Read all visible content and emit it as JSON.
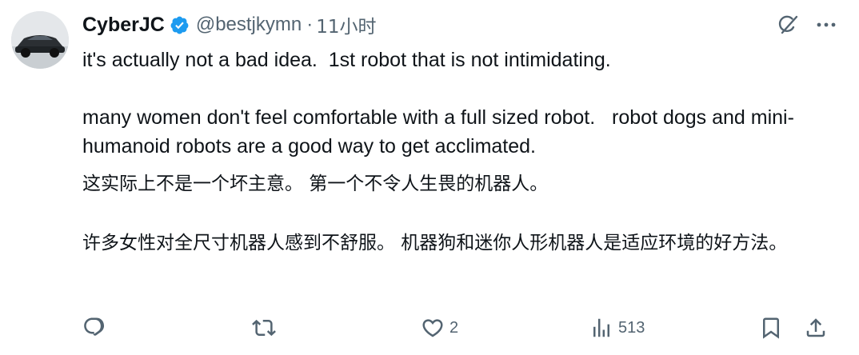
{
  "author": {
    "display_name": "CyberJC",
    "handle": "@bestjkymn",
    "separator": "·",
    "timestamp": "11小时",
    "verified": true,
    "verified_color": "#1d9bf0"
  },
  "tweet": {
    "text_line1": "it's actually not a bad idea.  1st robot that is not intimidating.",
    "text_line2": "many women don't feel comfortable with a full sized robot.   robot dogs and mini-humanoid robots are a good way to get acclimated."
  },
  "translation": {
    "line1": "这实际上不是一个坏主意。 第一个不令人生畏的机器人。",
    "line2": "许多女性对全尺寸机器人感到不舒服。 机器狗和迷你人形机器人是适应环境的好方法。"
  },
  "actions": {
    "reply": {
      "icon": "reply-icon",
      "count": ""
    },
    "retweet": {
      "icon": "retweet-icon",
      "count": ""
    },
    "like": {
      "icon": "heart-icon",
      "count": "2"
    },
    "views": {
      "icon": "views-icon",
      "count": "513"
    },
    "bookmark": {
      "icon": "bookmark-icon"
    },
    "share": {
      "icon": "share-icon"
    }
  },
  "top_icons": [
    "grok-icon",
    "more-icon"
  ],
  "colors": {
    "text": "#0f1419",
    "secondary": "#536471",
    "accent": "#1d9bf0"
  }
}
